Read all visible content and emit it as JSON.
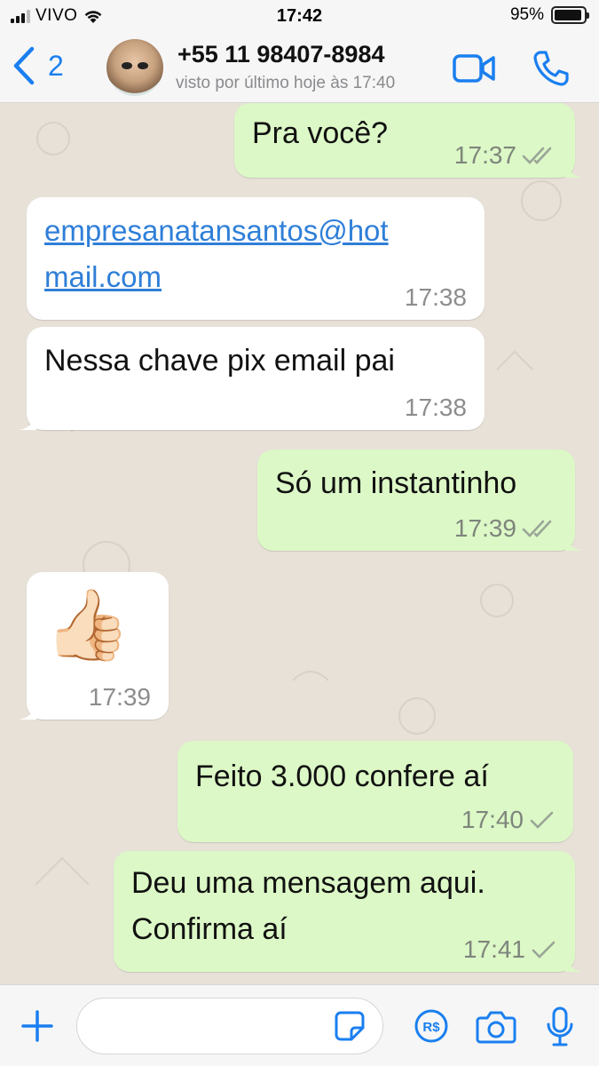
{
  "status_bar": {
    "carrier": "VIVO",
    "time": "17:42",
    "battery_percent": "95%",
    "battery_level": 0.95
  },
  "header": {
    "back_count": "2",
    "contact_name": "+55 11 98407-8984",
    "contact_status": "visto por último hoje às 17:40"
  },
  "messages": [
    {
      "direction": "out",
      "text": "Pra você?",
      "time": "17:37",
      "status": "read"
    },
    {
      "direction": "in",
      "text": "empresanatansantos@hot\nmail.com",
      "is_link": true,
      "time": "17:38"
    },
    {
      "direction": "in",
      "text": "Nessa chave pix email pai",
      "time": "17:38"
    },
    {
      "direction": "out",
      "text": "Só um instantinho",
      "time": "17:39",
      "status": "read"
    },
    {
      "direction": "in",
      "text": "👍🏻",
      "is_emoji": true,
      "time": "17:39"
    },
    {
      "direction": "out",
      "text": "Feito 3.000 confere aí",
      "time": "17:40",
      "status": "sent"
    },
    {
      "direction": "out",
      "text": "Deu uma mensagem aqui.\nConfirma aí",
      "time": "17:41",
      "status": "sent"
    }
  ],
  "input": {
    "value": ""
  },
  "icons": {
    "back": "chevron-left-icon",
    "video": "video-camera-icon",
    "phone": "phone-icon",
    "plus": "plus-icon",
    "sticker": "sticker-icon",
    "pix": "pix-payment-icon",
    "camera": "camera-icon",
    "mic": "microphone-icon"
  },
  "colors": {
    "accent": "#1a7ff0",
    "outgoing_bubble": "#dcf8c6",
    "incoming_bubble": "#ffffff",
    "read_ticks": "#8a9a88",
    "link": "#2f7fd8"
  }
}
